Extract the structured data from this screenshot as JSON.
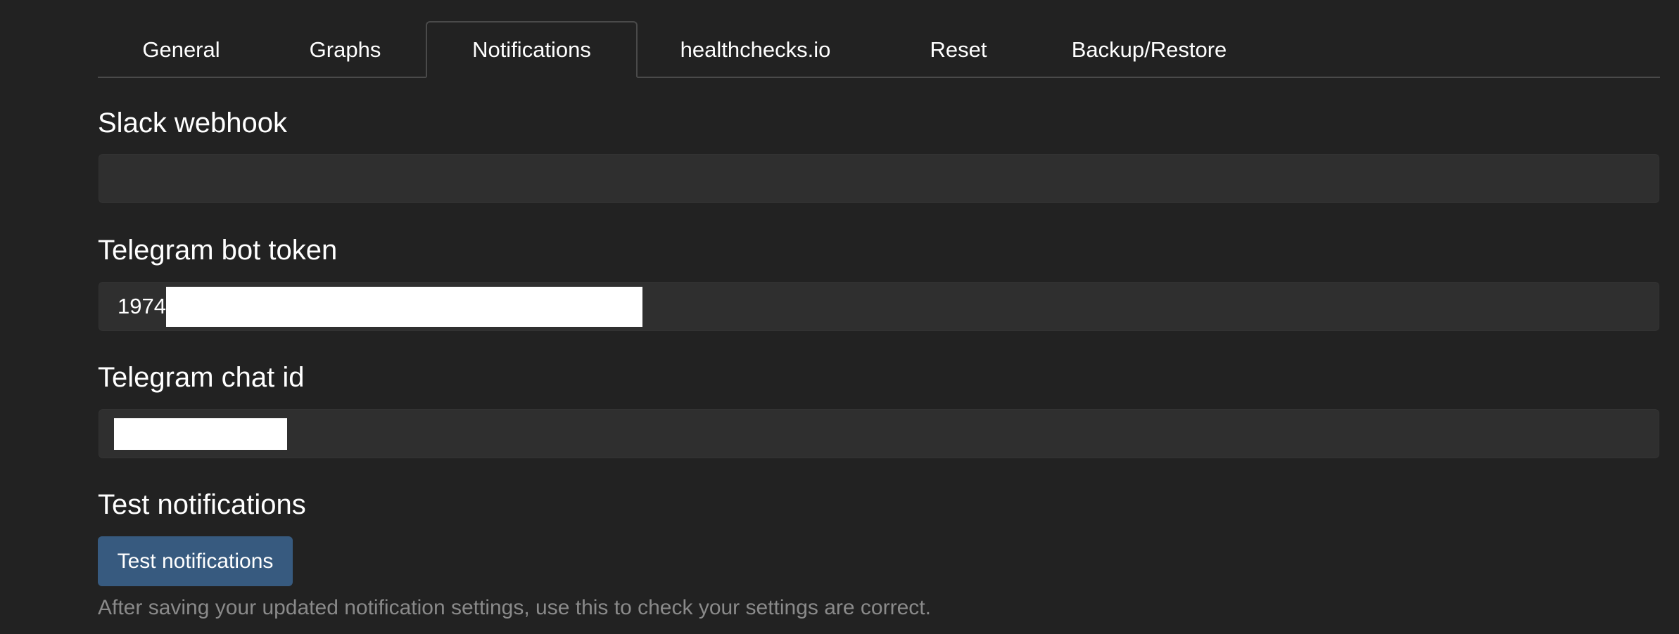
{
  "tabs": [
    {
      "label": "General"
    },
    {
      "label": "Graphs"
    },
    {
      "label": "Notifications",
      "active": true
    },
    {
      "label": "healthchecks.io"
    },
    {
      "label": "Reset"
    },
    {
      "label": "Backup/Restore"
    }
  ],
  "slack": {
    "title": "Slack webhook",
    "value": ""
  },
  "telegram_token": {
    "title": "Telegram bot token",
    "value_visible": "1974"
  },
  "telegram_chat": {
    "title": "Telegram chat id"
  },
  "test": {
    "title": "Test notifications",
    "button_label": "Test notifications",
    "help": "After saving your updated notification settings, use this to check your settings are correct."
  },
  "colors": {
    "background": "#222222",
    "field": "#2f2f2f",
    "button": "#375a7f",
    "help_text": "#8a8a8a"
  }
}
